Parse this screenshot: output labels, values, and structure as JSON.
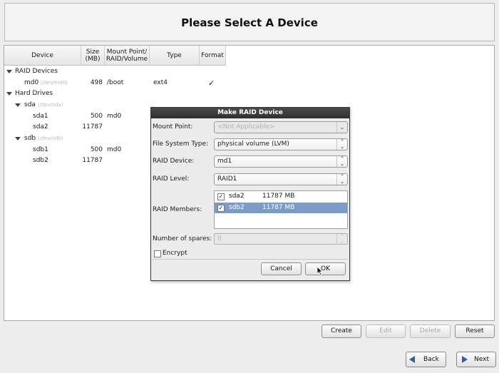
{
  "header": {
    "title": "Please Select A Device"
  },
  "table": {
    "columns": [
      "Device",
      "Size\n(MB)",
      "Mount Point/\nRAID/Volume",
      "Type",
      "Format"
    ],
    "col_size_1": "Size",
    "col_size_2": "(MB)",
    "col_mount_1": "Mount Point/",
    "col_mount_2": "RAID/Volume",
    "raid_group": "RAID Devices",
    "md0": {
      "name": "md0",
      "path": "(/dev/md0)",
      "size": "498",
      "mount": "/boot",
      "type": "ext4",
      "format": "✓"
    },
    "hard_drives": "Hard Drives",
    "sda": {
      "name": "sda",
      "path": "(/dev/sda)"
    },
    "sda1": {
      "name": "sda1",
      "size": "500",
      "mount": "md0"
    },
    "sda2": {
      "name": "sda2",
      "size": "11787"
    },
    "sdb": {
      "name": "sdb",
      "path": "(/dev/sdb)"
    },
    "sdb1": {
      "name": "sdb1",
      "size": "500",
      "mount": "md0"
    },
    "sdb2": {
      "name": "sdb2",
      "size": "11787"
    }
  },
  "dialog": {
    "title": "Make RAID Device",
    "mount_point_label": "Mount Point:",
    "mount_point_value": "<Not Applicable>",
    "fs_type_label": "File System Type:",
    "fs_type_value": "physical volume (LVM)",
    "raid_device_label": "RAID Device:",
    "raid_device_value": "md1",
    "raid_level_label": "RAID Level:",
    "raid_level_value": "RAID1",
    "raid_members_label": "RAID Members:",
    "members": [
      {
        "name": "sda2",
        "size": "11787 MB",
        "checked": true,
        "selected": false
      },
      {
        "name": "sdb2",
        "size": "11787 MB",
        "checked": true,
        "selected": true
      }
    ],
    "spares_label": "Number of spares:",
    "spares_value": "0",
    "encrypt_label": "Encrypt",
    "cancel_label": "Cancel",
    "ok_label": "OK",
    "check_glyph": "✓"
  },
  "actions": {
    "create": "Create",
    "edit": "Edit",
    "delete": "Delete",
    "reset": "Reset"
  },
  "nav": {
    "back": "Back",
    "next": "Next"
  },
  "colors": {
    "selection": "#7b9bc9",
    "next_arrow": "#2f5fa6",
    "back_arrow": "#2f5fa6"
  }
}
